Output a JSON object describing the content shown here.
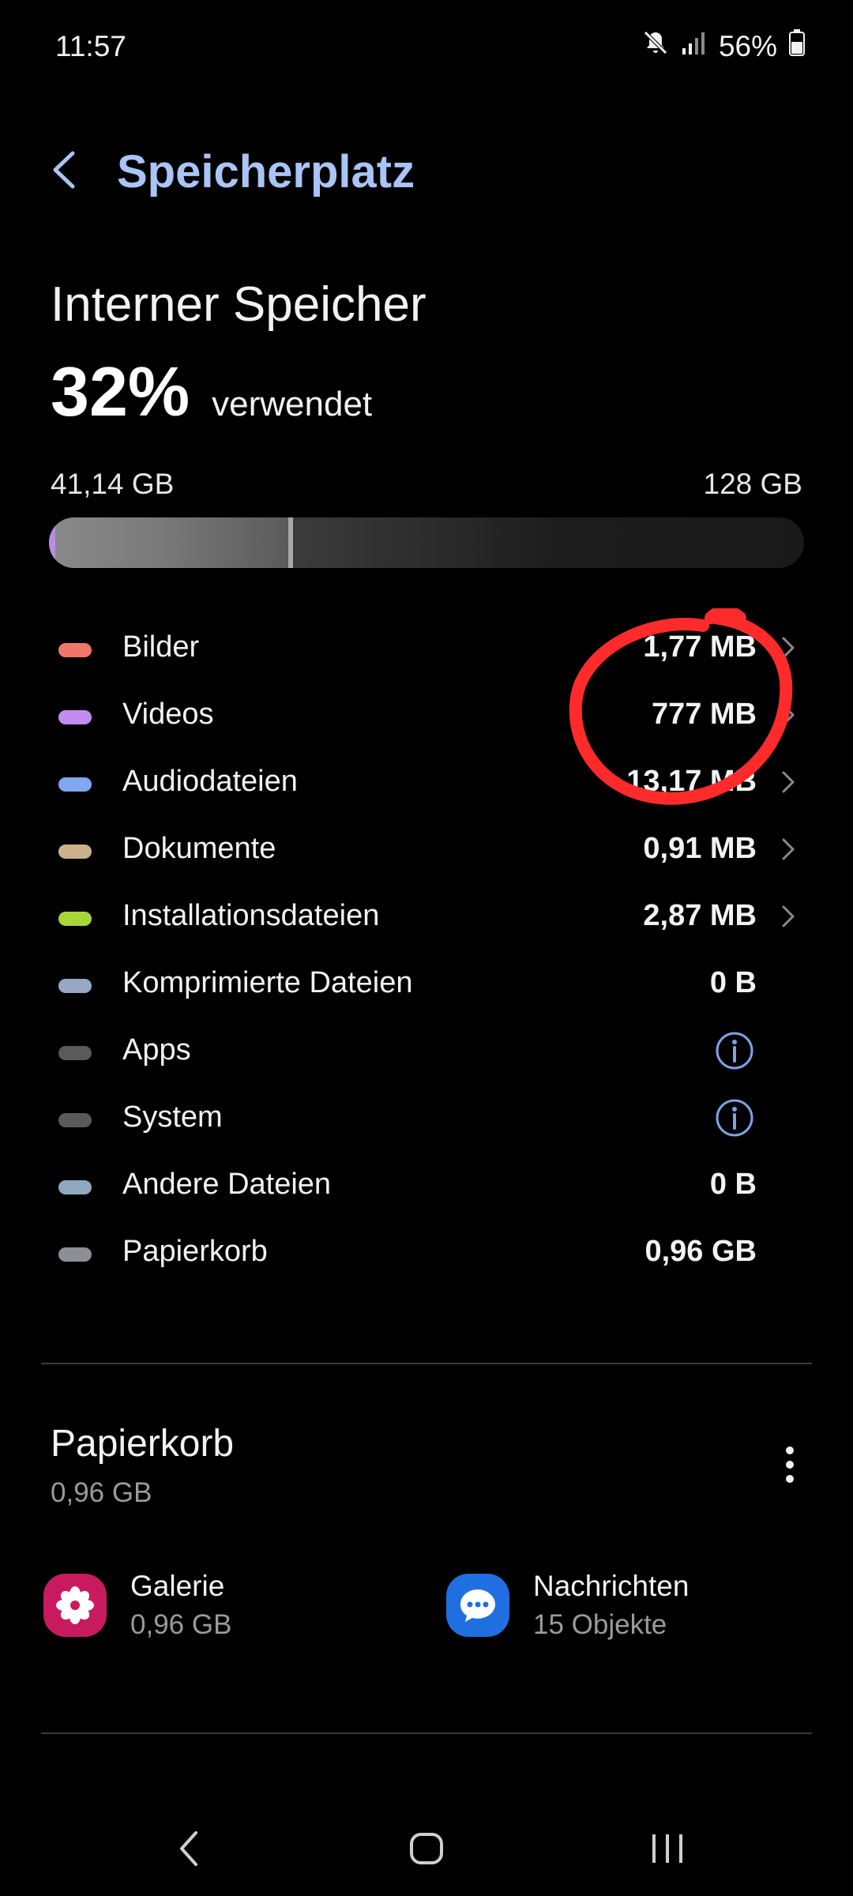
{
  "status_bar": {
    "time": "11:57",
    "battery": "56%",
    "icons": [
      "mute-icon",
      "signal-icon",
      "battery-icon"
    ]
  },
  "header": {
    "title": "Speicherplatz",
    "back_icon": "chevron-left-icon",
    "title_color": "#a9c4f5"
  },
  "storage": {
    "heading": "Interner Speicher",
    "percent": "32%",
    "percent_value": 0.32,
    "used_label": "verwendet",
    "used": "41,14 GB",
    "total": "128 GB"
  },
  "categories": [
    {
      "label": "Bilder",
      "value": "1,77 MB",
      "color": "#f0766b",
      "chevron": true,
      "info": false
    },
    {
      "label": "Videos",
      "value": "777 MB",
      "color": "#c38df0",
      "chevron": true,
      "info": false
    },
    {
      "label": "Audiodateien",
      "value": "13,17 MB",
      "color": "#7fa7f2",
      "chevron": true,
      "info": false
    },
    {
      "label": "Dokumente",
      "value": "0,91 MB",
      "color": "#c9b18c",
      "chevron": true,
      "info": false
    },
    {
      "label": "Installationsdateien",
      "value": "2,87 MB",
      "color": "#a6d63a",
      "chevron": true,
      "info": false
    },
    {
      "label": "Komprimierte Dateien",
      "value": "0 B",
      "color": "#98a8c4",
      "chevron": false,
      "info": false
    },
    {
      "label": "Apps",
      "value": "",
      "color": "#5a5a5a",
      "chevron": false,
      "info": true
    },
    {
      "label": "System",
      "value": "",
      "color": "#5a5a5a",
      "chevron": false,
      "info": true
    },
    {
      "label": "Andere Dateien",
      "value": "0 B",
      "color": "#8fa8c0",
      "chevron": false,
      "info": false
    },
    {
      "label": "Papierkorb",
      "value": "0,96 GB",
      "color": "#8e8e96",
      "chevron": false,
      "info": false
    }
  ],
  "trash": {
    "title": "Papierkorb",
    "size": "0,96 GB",
    "apps": [
      {
        "name": "Galerie",
        "sub": "0,96 GB",
        "icon": "gallery-icon",
        "color": "#c81b5f"
      },
      {
        "name": "Nachrichten",
        "sub": "15 Objekte",
        "icon": "messages-icon",
        "color": "#1f6fe0"
      }
    ]
  },
  "annotation": {
    "color": "#ff2b2b"
  },
  "nav_bar": [
    "nav-back-icon",
    "nav-home-icon",
    "nav-recents-icon"
  ]
}
